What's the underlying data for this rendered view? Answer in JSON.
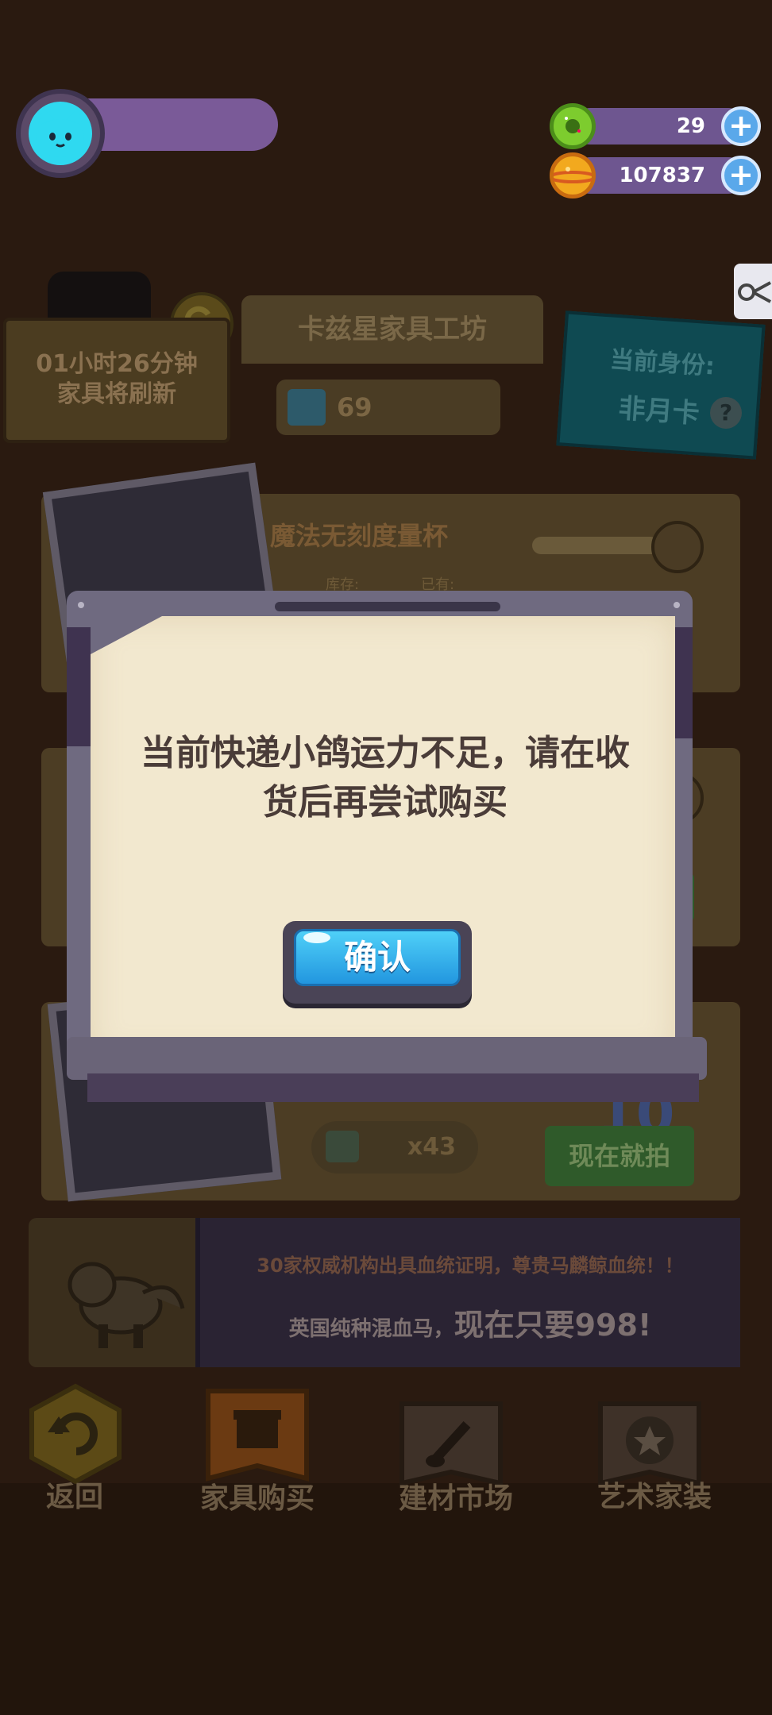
{
  "hud": {
    "currency_green": {
      "icon": "green-donut-icon",
      "value": "29"
    },
    "currency_gold": {
      "icon": "gold-planet-icon",
      "value": "107837"
    }
  },
  "shop": {
    "refresh_timer_line1": "01小时26分钟",
    "refresh_timer_line2": "家具将刷新",
    "title": "卡兹星家具工坊",
    "coins": "69",
    "status_label": "当前身份:",
    "status_value": "非月卡",
    "items": [
      {
        "name": "魔法无刻度量杯",
        "stock_label": "库存:",
        "owned_label": "已有:"
      },
      {
        "quantity": "x43",
        "big_number": "10",
        "action_label": "现在就拍"
      }
    ]
  },
  "ad_banner": {
    "line1": "30家权威机构出具血统证明，尊贵马麟鲸血统！！",
    "line2_prefix": "英国纯种混血马，",
    "line2_highlight": "现在只要998!"
  },
  "bottom_nav": [
    {
      "label": "返回",
      "icon": "back-arrow-icon"
    },
    {
      "label": "家具购买",
      "icon": "gift-icon"
    },
    {
      "label": "建材市场",
      "icon": "brush-icon"
    },
    {
      "label": "艺术家装",
      "icon": "star-icon"
    }
  ],
  "dialog": {
    "message_line1": "当前快递小鸽运力不足，请在收",
    "message_line2": "货后再尝试购买",
    "confirm_label": "确认"
  },
  "colors": {
    "dialog_paper": "#f2e8cf",
    "confirm_button": "#2fb4ee",
    "hud_pill": "#6e5690"
  }
}
